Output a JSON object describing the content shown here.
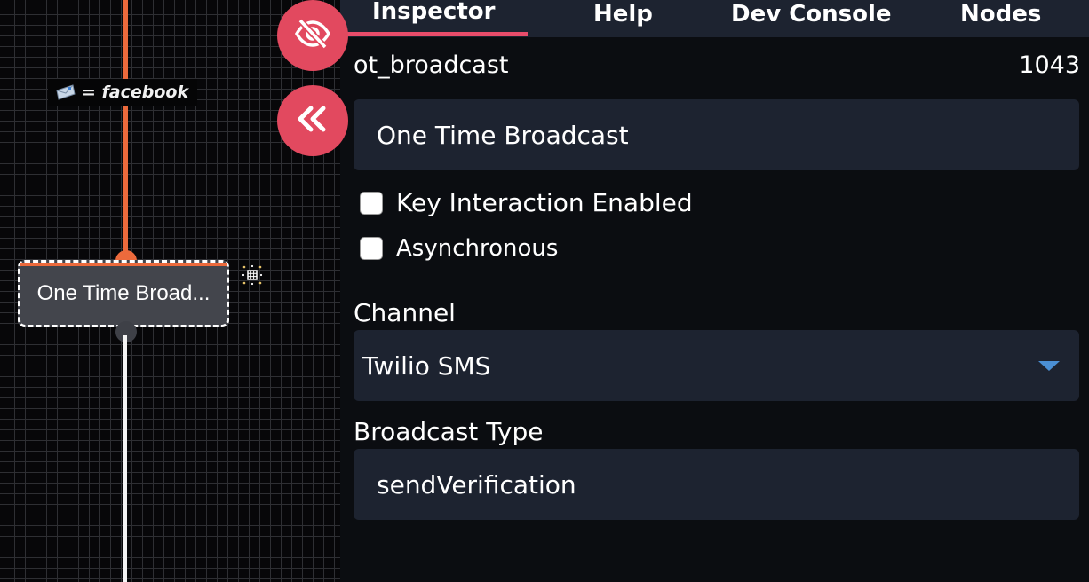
{
  "canvas": {
    "edge_label": "= facebook",
    "edge_icon": "mail-icon",
    "node_label": "One Time Broad...",
    "node_tool_icon": "target-grid-icon",
    "colors": {
      "wire_in": "#ec6a3c",
      "wire_out": "#f4f4f4",
      "node_bg": "#43454c"
    }
  },
  "floating_buttons": {
    "hide_icon": "eye-slash-icon",
    "collapse_icon": "double-chevron-left-icon",
    "color": "#e2495f"
  },
  "tabs": [
    {
      "label": "Inspector",
      "active": true
    },
    {
      "label": "Help"
    },
    {
      "label": "Dev Console"
    },
    {
      "label": "Nodes"
    }
  ],
  "inspector": {
    "node_key": "ot_broadcast",
    "node_id": "1043",
    "name_value": "One Time Broadcast",
    "checkboxes": [
      {
        "label": "Key Interaction Enabled",
        "checked": false
      },
      {
        "label": "Asynchronous",
        "checked": false
      }
    ],
    "channel": {
      "label": "Channel",
      "value": "Twilio SMS"
    },
    "broadcast_type": {
      "label": "Broadcast Type",
      "value": "sendVerification"
    }
  },
  "colors": {
    "accent": "#e84c6a",
    "field_bg": "#1d2330",
    "panel_bg": "#0b0d11",
    "caret": "#4a8fd4"
  }
}
